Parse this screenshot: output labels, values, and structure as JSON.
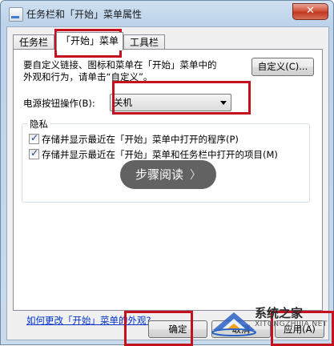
{
  "window": {
    "title": "任务栏和「开始」菜单属性",
    "close_glyph": "✕"
  },
  "tabs": [
    {
      "label": "任务栏"
    },
    {
      "label": "「开始」菜单"
    },
    {
      "label": "工具栏"
    }
  ],
  "start_menu_tab": {
    "description_line1": "要自定义链接、图标和菜单在「开始」菜单中的",
    "description_line2": "外观和行为，请单击“自定义”。",
    "customize_button": "自定义(C)...",
    "power_label": "电源按钮操作(B):",
    "power_selected": "关机",
    "privacy": {
      "title": "隐私",
      "items": [
        {
          "label": "存储并显示最近在「开始」菜单中打开的程序(P)",
          "checked": true
        },
        {
          "label": "存储并显示最近在「开始」菜单和任务栏中打开的项目(M)",
          "checked": true
        }
      ]
    },
    "help_link": "如何更改「开始」菜单的外观?"
  },
  "footer": {
    "ok": "确定",
    "cancel": "取消",
    "apply": "应用(A)"
  },
  "overlay": {
    "label": "步骤阅读",
    "chevron": "〉"
  },
  "watermark": {
    "site": "系统之家",
    "url": "XITONGZHIJIA.NET"
  },
  "colors": {
    "highlight": "#c4101f",
    "link": "#0033cc",
    "title_bar": "#bcd3ea"
  }
}
